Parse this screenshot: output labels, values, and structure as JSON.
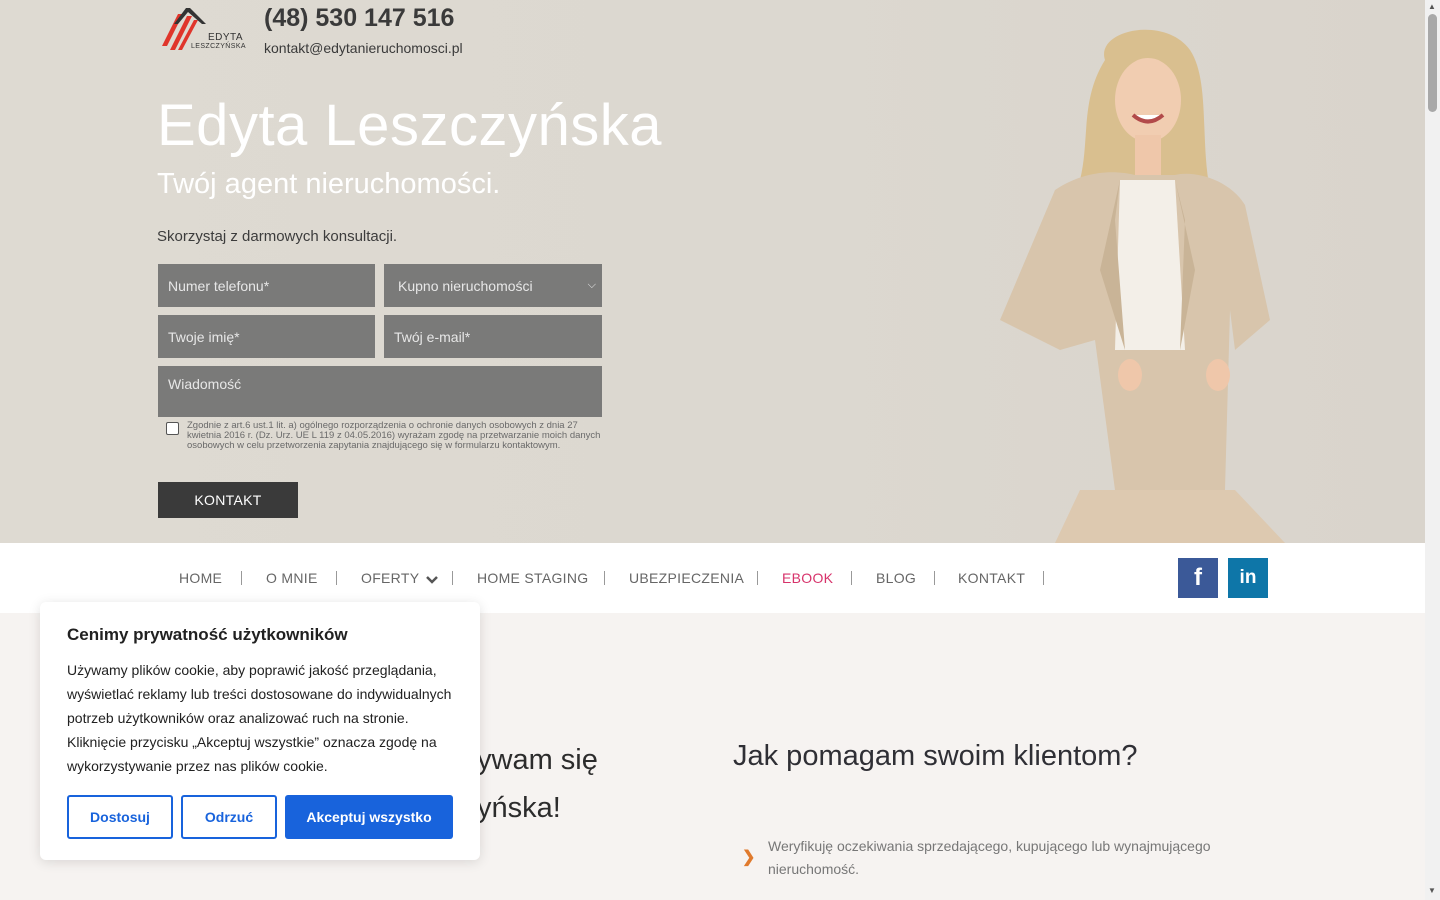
{
  "header": {
    "logo_line1": "EDYTA",
    "logo_line2": "LESZCZYŃSKA",
    "phone": "(48) 530 147 516",
    "email": "kontakt@edytanieruchomosci.pl"
  },
  "hero": {
    "title": "Edyta Leszczyńska",
    "subtitle": "Twój agent nieruchomości.",
    "lead": "Skorzystaj z darmowych konsultacji."
  },
  "form": {
    "phone_placeholder": "Numer telefonu*",
    "select_value": "Kupno nieruchomości",
    "name_placeholder": "Twoje imię*",
    "email_placeholder": "Twój e-mail*",
    "message_placeholder": "Wiadomość",
    "consent": "Zgodnie z art.6 ust.1 lit. a) ogólnego rozporządzenia o ochronie danych osobowych z dnia 27 kwietnia 2016 r. (Dz. Urz. UE L 119 z 04.05.2016) wyrażam zgodę na przetwarzanie moich danych osobowych w celu przetworzenia zapytania znajdującego się w formularzu kontaktowym.",
    "submit": "KONTAKT"
  },
  "nav": {
    "items": [
      "HOME",
      "O MNIE",
      "OFERTY",
      "HOME STAGING",
      "UBEZPIECZENIA",
      "EBOOK",
      "BLOG",
      "KONTAKT"
    ],
    "fb": "f",
    "li": "in",
    "active_color": "#d7336b"
  },
  "content": {
    "left_heading_line1": "ywam się",
    "left_heading_line2": "yńska!",
    "right_heading": "Jak pomagam swoim klientom?",
    "bullet1": "Weryfikuję oczekiwania  sprzedającego, kupującego lub wynajmującego nieruchomość."
  },
  "cookie": {
    "title": "Cenimy prywatność użytkowników",
    "body": "Używamy plików cookie, aby poprawić jakość przeglądania, wyświetlać reklamy lub treści dostosowane do indywidualnych potrzeb użytkowników oraz analizować ruch na stronie. Kliknięcie przycisku „Akceptuj wszystkie” oznacza zgodę na wykorzystywanie przez nas plików cookie.",
    "customize": "Dostosuj",
    "reject": "Odrzuć",
    "accept": "Akceptuj wszystko",
    "accent": "#1863dc"
  }
}
